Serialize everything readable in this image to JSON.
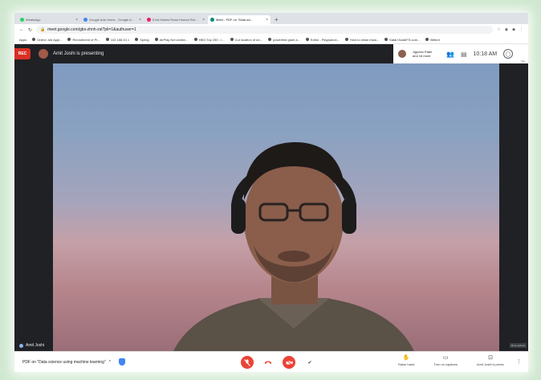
{
  "browser": {
    "tabs": [
      {
        "title": "WhatsApp",
        "color": "#25d366",
        "active": false
      },
      {
        "title": "Google Arts Home - Google A...",
        "color": "#4285f4",
        "active": false
      },
      {
        "title": "5 Art Haters Road Human Rol...",
        "color": "#e91e63",
        "active": false
      },
      {
        "title": "Meet - PDF on \"Data sci...",
        "color": "#00897b",
        "active": true
      }
    ],
    "new_tab": "+",
    "url": "meet.google.com/gbx-zhnh-zst?pli=1&authuser=1",
    "bookmarks": [
      "Apps",
      "Online Job Appl...",
      "Recruitment of Pr...",
      "102.188.10.1",
      "Spring",
      "AirPlay Not workin...",
      "HBO Top 250 - I...",
      "Cut location of an...",
      "powerfest giant a...",
      "Editor - Playpanon...",
      "How to clean insta...",
      "Safari.NodeFS.com...",
      "Bitfont"
    ]
  },
  "meet": {
    "rec_label": "REC",
    "presenting_text": "Amit Joshi is presenting",
    "participants_name": "Jignesh Patel",
    "participants_more": "and 16 more",
    "time": "10:18 AM",
    "you_label": "You",
    "self_name": "Amit Joshi",
    "side_tag": "More options",
    "meeting_title": "PDF on \"Data science using machine learning\"",
    "details_chevron": "^",
    "controls": {
      "raise_hand": "Raise hand",
      "captions": "Turn on captions",
      "presenting": "Amit Joshi is presenting"
    }
  },
  "colors": {
    "danger": "#ea4335",
    "meet_dark": "#202124"
  }
}
